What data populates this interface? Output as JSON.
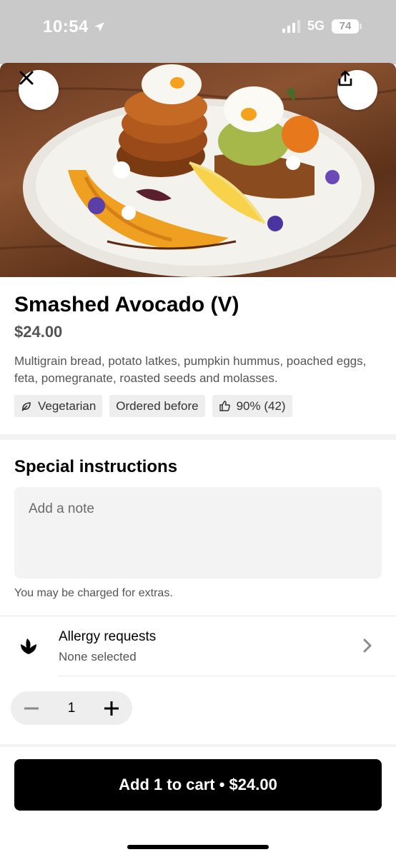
{
  "status_bar": {
    "time": "10:54",
    "network": "5G",
    "battery": "74"
  },
  "item": {
    "title": "Smashed Avocado (V)",
    "price": "$24.00",
    "description": "Multigrain bread, potato latkes, pumpkin hummus, poached eggs, feta, pomegranate, roasted seeds and molasses.",
    "tags": [
      {
        "label": "Vegetarian",
        "icon": "leaf-icon"
      },
      {
        "label": "Ordered before",
        "icon": ""
      },
      {
        "label": "90% (42)",
        "icon": "thumbs-up-icon"
      }
    ]
  },
  "special_instructions": {
    "title": "Special instructions",
    "placeholder": "Add a note",
    "note": "You may be charged for extras."
  },
  "allergy": {
    "title": "Allergy requests",
    "subtitle": "None selected"
  },
  "quantity": {
    "value": "1"
  },
  "cart_button": {
    "label": "Add 1 to cart • $24.00"
  },
  "colors": {
    "primary": "#000000",
    "secondary_text": "#545454",
    "chip_bg": "#eeeeee"
  }
}
